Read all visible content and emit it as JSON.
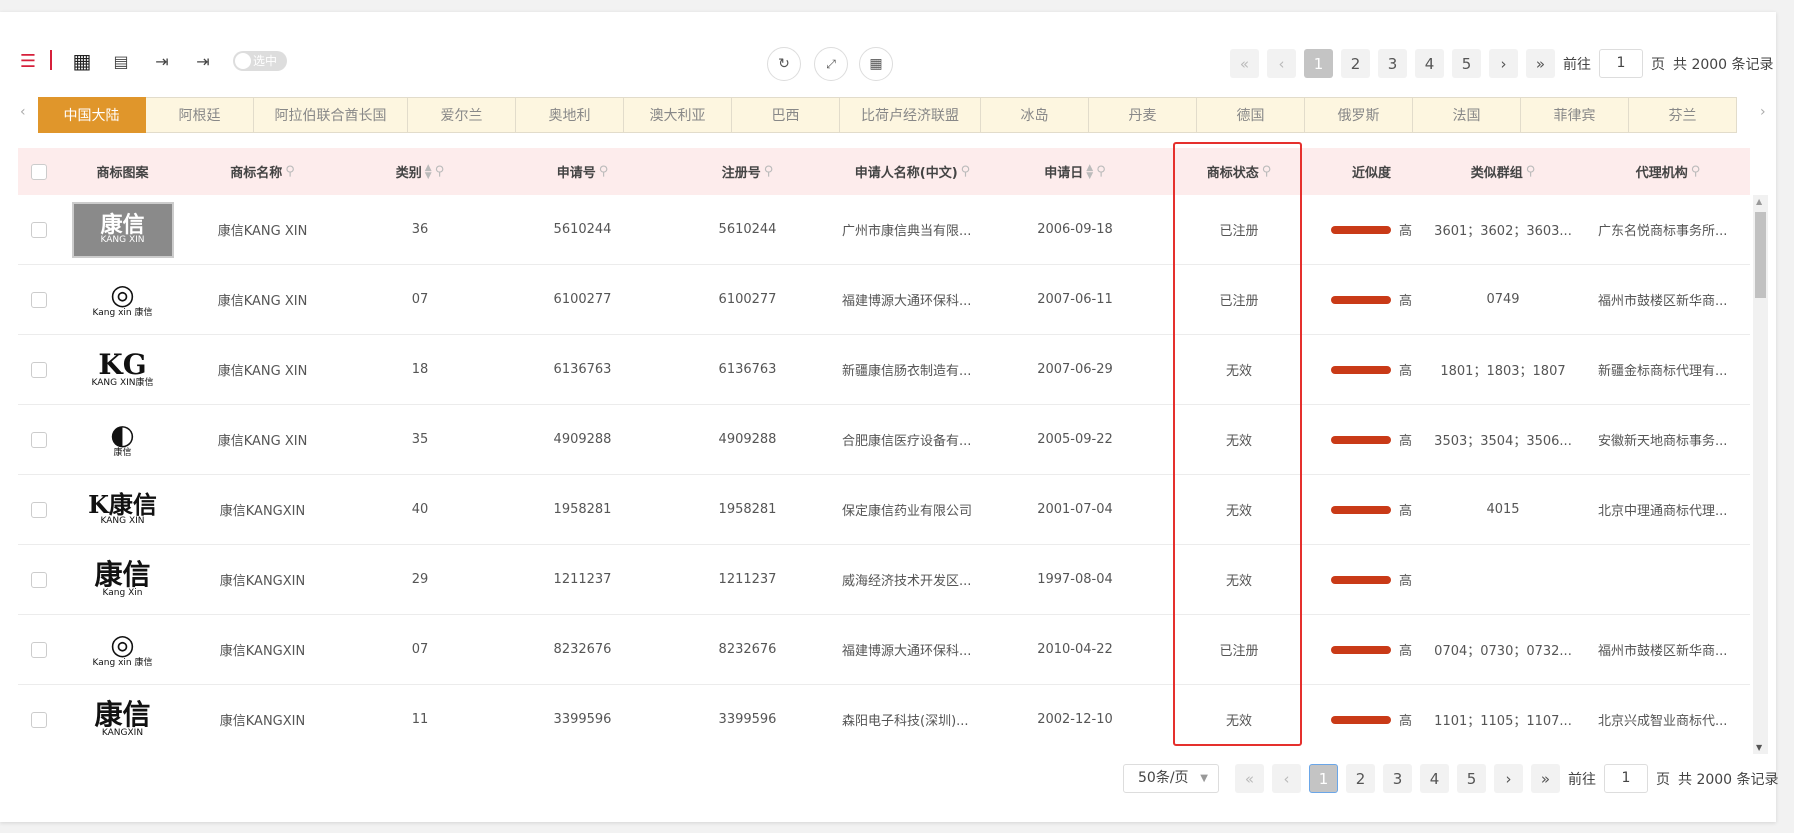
{
  "toolbar": {
    "toggle_label": "选中",
    "icons": [
      "list-view-icon",
      "grid-view-icon",
      "report-icon",
      "export-doc-icon",
      "export-xls-icon"
    ],
    "center_icons": [
      "refresh-icon",
      "fullscreen-icon",
      "layout-icon"
    ]
  },
  "pagination": {
    "first": "«",
    "prev": "‹",
    "pages": [
      "1",
      "2",
      "3",
      "4",
      "5"
    ],
    "next": "›",
    "last": "»",
    "goto_label": "前往",
    "goto_value": "1",
    "page_suffix": "页",
    "total": "共 2000 条记录",
    "page_size": "50条/页"
  },
  "country_tabs": [
    "中国大陆",
    "阿根廷",
    "阿拉伯联合酋长国",
    "爱尔兰",
    "奥地利",
    "澳大利亚",
    "巴西",
    "比荷卢经济联盟",
    "冰岛",
    "丹麦",
    "德国",
    "俄罗斯",
    "法国",
    "菲律宾",
    "芬兰"
  ],
  "columns": [
    "商标图案",
    "商标名称",
    "类别",
    "申请号",
    "注册号",
    "申请人名称(中文)",
    "申请日",
    "商标状态",
    "近似度",
    "类似群组",
    "代理机构"
  ],
  "rows": [
    {
      "logo": "康信",
      "logo_sub": "KANG XIN",
      "name": "康信KANG XIN",
      "class": "36",
      "app_no": "5610244",
      "reg_no": "5610244",
      "applicant": "广州市康信典当有限...",
      "date": "2006-09-18",
      "status": "已注册",
      "similarity": "高",
      "group": "3601；3602；3603...",
      "agent": "广东名悦商标事务所..."
    },
    {
      "logo": "◎",
      "logo_sub": "Kang xin 康信",
      "name": "康信KANG XIN",
      "class": "07",
      "app_no": "6100277",
      "reg_no": "6100277",
      "applicant": "福建博源大通环保科...",
      "date": "2007-06-11",
      "status": "已注册",
      "similarity": "高",
      "group": "0749",
      "agent": "福州市鼓楼区新华商..."
    },
    {
      "logo": "KG",
      "logo_sub": "KANG XIN康信",
      "name": "康信KANG XIN",
      "class": "18",
      "app_no": "6136763",
      "reg_no": "6136763",
      "applicant": "新疆康信肠衣制造有...",
      "date": "2007-06-29",
      "status": "无效",
      "similarity": "高",
      "group": "1801；1803；1807",
      "agent": "新疆金标商标代理有..."
    },
    {
      "logo": "◐",
      "logo_sub": "康信",
      "name": "康信KANG XIN",
      "class": "35",
      "app_no": "4909288",
      "reg_no": "4909288",
      "applicant": "合肥康信医疗设备有...",
      "date": "2005-09-22",
      "status": "无效",
      "similarity": "高",
      "group": "3503；3504；3506...",
      "agent": "安徽新天地商标事务..."
    },
    {
      "logo": "K康信",
      "logo_sub": "KANG XIN",
      "name": "康信KANGXIN",
      "class": "40",
      "app_no": "1958281",
      "reg_no": "1958281",
      "applicant": "保定康信药业有限公司",
      "date": "2001-07-04",
      "status": "无效",
      "similarity": "高",
      "group": "4015",
      "agent": "北京中理通商标代理..."
    },
    {
      "logo": "康信",
      "logo_sub": "Kang Xin",
      "name": "康信KANGXIN",
      "class": "29",
      "app_no": "1211237",
      "reg_no": "1211237",
      "applicant": "威海经济技术开发区...",
      "date": "1997-08-04",
      "status": "无效",
      "similarity": "高",
      "group": "",
      "agent": ""
    },
    {
      "logo": "◎",
      "logo_sub": "Kang xin 康信",
      "name": "康信KANGXIN",
      "class": "07",
      "app_no": "8232676",
      "reg_no": "8232676",
      "applicant": "福建博源大通环保科...",
      "date": "2010-04-22",
      "status": "已注册",
      "similarity": "高",
      "group": "0704；0730；0732...",
      "agent": "福州市鼓楼区新华商..."
    },
    {
      "logo": "康信",
      "logo_sub": "KANGXIN",
      "name": "康信KANGXIN",
      "class": "11",
      "app_no": "3399596",
      "reg_no": "3399596",
      "applicant": "森阳电子科技(深圳)...",
      "date": "2002-12-10",
      "status": "无效",
      "similarity": "高",
      "group": "1101；1105；1107...",
      "agent": "北京兴成智业商标代..."
    }
  ],
  "colors": {
    "tab_active": "#e0962b",
    "header_bg": "#fdecec",
    "similarity_bar": "#c93a17",
    "highlight_box": "#e5302d"
  }
}
